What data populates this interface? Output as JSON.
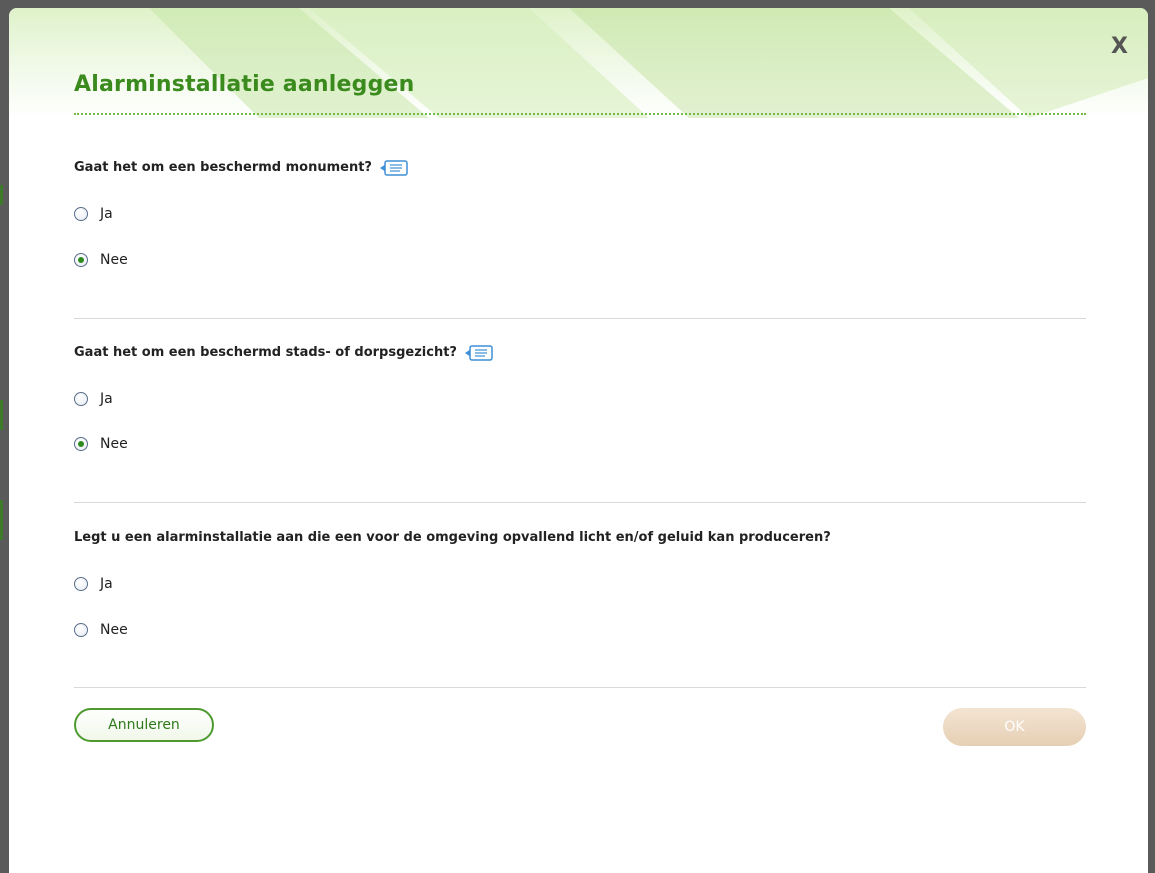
{
  "dialog": {
    "title": "Alarminstallatie aanleggen",
    "close_label": "X"
  },
  "questions": [
    {
      "label": "Gaat het om een beschermd monument?",
      "has_help": true,
      "options": [
        {
          "label": "Ja",
          "selected": false
        },
        {
          "label": "Nee",
          "selected": true
        }
      ]
    },
    {
      "label": "Gaat het om een beschermd stads- of dorpsgezicht?",
      "has_help": true,
      "options": [
        {
          "label": "Ja",
          "selected": false
        },
        {
          "label": "Nee",
          "selected": true
        }
      ]
    },
    {
      "label": "Legt u een alarminstallatie aan die een voor de omgeving opvallend licht en/of geluid kan produceren?",
      "has_help": false,
      "options": [
        {
          "label": "Ja",
          "selected": false
        },
        {
          "label": "Nee",
          "selected": false
        }
      ]
    }
  ],
  "buttons": {
    "cancel_label": "Annuleren",
    "ok_label": "OK",
    "ok_enabled": false
  },
  "icons": {
    "help": "speech-bubble-icon",
    "close": "close-icon"
  },
  "colors": {
    "accent": "#3a8a1e",
    "radio_dot": "#2d8a1e",
    "ok_disabled": "#e6cfb4"
  }
}
